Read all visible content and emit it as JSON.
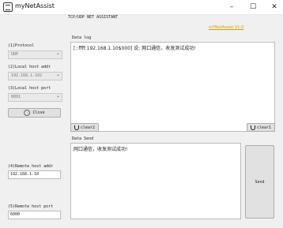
{
  "window": {
    "title": "myNetAssist",
    "minimize": "–",
    "maximize": "☐",
    "close": "✕"
  },
  "header": {
    "label": "TCP/UDP NET ASSISTANT",
    "brand_link": "mYNetAssist V1.0"
  },
  "left": {
    "protocol": {
      "label": "(1)Protocol",
      "value": "UDP"
    },
    "local_host_addr": {
      "label": "(2)Local host addr",
      "value": "192.168.1.102"
    },
    "local_host_port": {
      "label": "(3)Local host port",
      "value": "8001"
    },
    "close_button": "Close",
    "remote_host_addr": {
      "label": "(4)Remote host addr",
      "value": "192.168.1.10"
    },
    "remote_host_port": {
      "label": "(5)Remote host port",
      "value": "6000"
    }
  },
  "data_log": {
    "label": "Data log",
    "text": "[::ffff:192.168.1.10$000] 说: 网口通信，收发测试成功!"
  },
  "buttons": {
    "clear2": "clear2",
    "clear1": "clear1",
    "send": "Send"
  },
  "data_send": {
    "label": "Data Send",
    "text": "网口通信，收发测试成功!"
  },
  "colors": {
    "brand_link": "#d4a000",
    "background": "#f0f0f0"
  },
  "icons": [
    "app-icon",
    "chevron-down-icon",
    "close-circle-icon",
    "magnet-icon"
  ]
}
